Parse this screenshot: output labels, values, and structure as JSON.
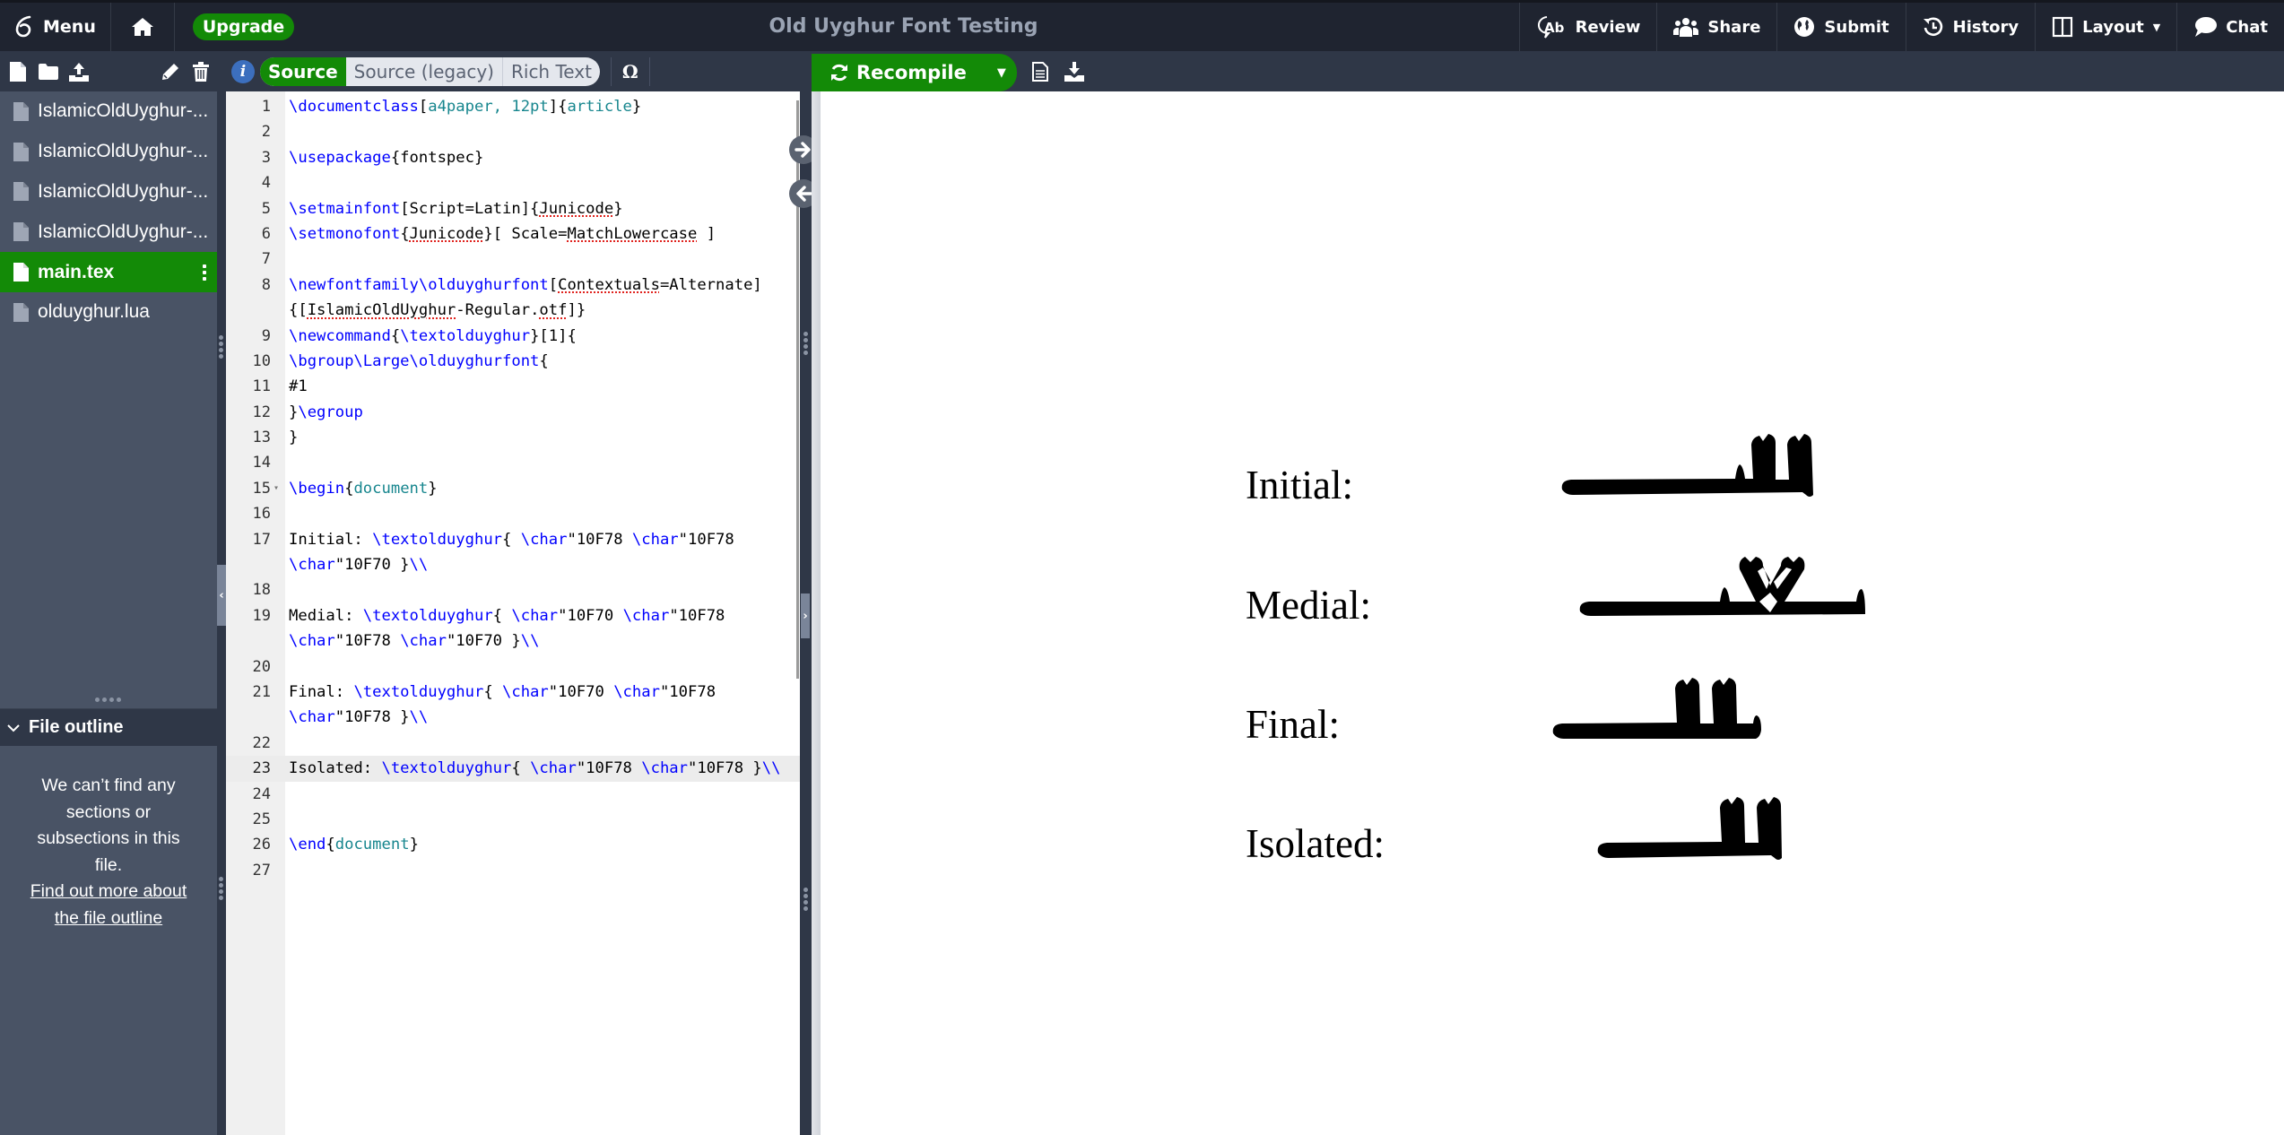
{
  "topbar": {
    "menu_label": "Menu",
    "upgrade_label": "Upgrade",
    "project_title": "Old Uyghur Font Testing",
    "actions": [
      {
        "label": "Review",
        "icon": "review-icon"
      },
      {
        "label": "Share",
        "icon": "share-icon"
      },
      {
        "label": "Submit",
        "icon": "globe-icon"
      },
      {
        "label": "History",
        "icon": "history-icon"
      },
      {
        "label": "Layout",
        "icon": "layout-icon"
      },
      {
        "label": "Chat",
        "icon": "chat-icon"
      }
    ]
  },
  "editor_toolbar": {
    "modes": [
      "Source",
      "Source (legacy)",
      "Rich Text"
    ],
    "active_mode": "Source",
    "omega": "Ω"
  },
  "pdf_toolbar": {
    "recompile_label": "Recompile"
  },
  "file_tree": {
    "files": [
      {
        "name": "IslamicOldUyghur-...",
        "selected": false
      },
      {
        "name": "IslamicOldUyghur-...",
        "selected": false
      },
      {
        "name": "IslamicOldUyghur-...",
        "selected": false
      },
      {
        "name": "IslamicOldUyghur-...",
        "selected": false
      },
      {
        "name": "main.tex",
        "selected": true
      },
      {
        "name": "olduyghur.lua",
        "selected": false
      }
    ]
  },
  "file_outline": {
    "title": "File outline",
    "empty_message": "We can’t find any sections or subsections in this file.",
    "link_text": "Find out more about the file outline"
  },
  "editor": {
    "active_line": 23,
    "lines": [
      {
        "n": "1",
        "segs": [
          [
            "kw",
            "\\documentclass"
          ],
          [
            "",
            "["
          ],
          [
            "arg",
            "a4paper, 12pt"
          ],
          [
            "",
            "]{"
          ],
          [
            "arg",
            "article"
          ],
          [
            "",
            "}"
          ]
        ]
      },
      {
        "n": "2",
        "segs": []
      },
      {
        "n": "3",
        "segs": [
          [
            "kw",
            "\\usepackage"
          ],
          [
            "",
            "{fontspec}"
          ]
        ]
      },
      {
        "n": "4",
        "segs": []
      },
      {
        "n": "5",
        "segs": [
          [
            "kw",
            "\\setmainfont"
          ],
          [
            "",
            "[Script=Latin]{"
          ],
          [
            "sp",
            "Junicode"
          ],
          [
            "",
            "}"
          ]
        ]
      },
      {
        "n": "6",
        "segs": [
          [
            "kw",
            "\\setmonofont"
          ],
          [
            "",
            "{"
          ],
          [
            "sp",
            "Junicode"
          ],
          [
            "",
            "}[ Scale="
          ],
          [
            "sp",
            "MatchLowercase"
          ],
          [
            "",
            " ]"
          ]
        ]
      },
      {
        "n": "7",
        "segs": []
      },
      {
        "n": "8",
        "segs": [
          [
            "kw",
            "\\newfontfamily\\olduyghurfont"
          ],
          [
            "",
            "["
          ],
          [
            "sp",
            "Contextuals"
          ],
          [
            "",
            "=Alternate]"
          ]
        ]
      },
      {
        "n": "",
        "segs": [
          [
            "",
            "{["
          ],
          [
            "sp",
            "IslamicOldUyghur"
          ],
          [
            "",
            "-Regular."
          ],
          [
            "sp",
            "otf"
          ],
          [
            "",
            "]}"
          ]
        ]
      },
      {
        "n": "9",
        "segs": [
          [
            "kw",
            "\\newcommand"
          ],
          [
            "",
            "{"
          ],
          [
            "kw",
            "\\textolduyghur"
          ],
          [
            "",
            "}[1]{"
          ]
        ]
      },
      {
        "n": "10",
        "segs": [
          [
            "kw",
            "\\bgroup\\Large\\olduyghurfont"
          ],
          [
            "",
            "{"
          ]
        ]
      },
      {
        "n": "11",
        "segs": [
          [
            "",
            "#1"
          ]
        ]
      },
      {
        "n": "12",
        "segs": [
          [
            "",
            "}"
          ],
          [
            "kw",
            "\\egroup"
          ]
        ]
      },
      {
        "n": "13",
        "segs": [
          [
            "",
            "}"
          ]
        ]
      },
      {
        "n": "14",
        "segs": []
      },
      {
        "n": "15",
        "fold": true,
        "segs": [
          [
            "kw",
            "\\begin"
          ],
          [
            "",
            "{"
          ],
          [
            "arg",
            "document"
          ],
          [
            "",
            "}"
          ]
        ]
      },
      {
        "n": "16",
        "segs": []
      },
      {
        "n": "17",
        "segs": [
          [
            "",
            "Initial: "
          ],
          [
            "kw",
            "\\textolduyghur"
          ],
          [
            "",
            "{ "
          ],
          [
            "kw",
            "\\char"
          ],
          [
            "",
            "\"10F78 "
          ],
          [
            "kw",
            "\\char"
          ],
          [
            "",
            "\"10F78"
          ]
        ]
      },
      {
        "n": "",
        "segs": [
          [
            "kw",
            "\\char"
          ],
          [
            "",
            "\"10F70 }"
          ],
          [
            "kw",
            "\\\\"
          ]
        ]
      },
      {
        "n": "18",
        "segs": []
      },
      {
        "n": "19",
        "segs": [
          [
            "",
            "Medial: "
          ],
          [
            "kw",
            "\\textolduyghur"
          ],
          [
            "",
            "{ "
          ],
          [
            "kw",
            "\\char"
          ],
          [
            "",
            "\"10F70 "
          ],
          [
            "kw",
            "\\char"
          ],
          [
            "",
            "\"10F78"
          ]
        ]
      },
      {
        "n": "",
        "segs": [
          [
            "kw",
            "\\char"
          ],
          [
            "",
            "\"10F78 "
          ],
          [
            "kw",
            "\\char"
          ],
          [
            "",
            "\"10F70 }"
          ],
          [
            "kw",
            "\\\\"
          ]
        ]
      },
      {
        "n": "20",
        "segs": []
      },
      {
        "n": "21",
        "segs": [
          [
            "",
            "Final: "
          ],
          [
            "kw",
            "\\textolduyghur"
          ],
          [
            "",
            "{ "
          ],
          [
            "kw",
            "\\char"
          ],
          [
            "",
            "\"10F70 "
          ],
          [
            "kw",
            "\\char"
          ],
          [
            "",
            "\"10F78"
          ]
        ]
      },
      {
        "n": "",
        "segs": [
          [
            "kw",
            "\\char"
          ],
          [
            "",
            "\"10F78 }"
          ],
          [
            "kw",
            "\\\\"
          ]
        ]
      },
      {
        "n": "22",
        "segs": []
      },
      {
        "n": "23",
        "segs": [
          [
            "",
            "Isolated: "
          ],
          [
            "kw",
            "\\textolduyghur"
          ],
          [
            "",
            "{ "
          ],
          [
            "kw",
            "\\char"
          ],
          [
            "",
            "\"10F78 "
          ],
          [
            "kw",
            "\\char"
          ],
          [
            "",
            "\"10F78 }"
          ],
          [
            "kw",
            "\\\\"
          ]
        ]
      },
      {
        "n": "24",
        "segs": []
      },
      {
        "n": "25",
        "segs": []
      },
      {
        "n": "26",
        "segs": [
          [
            "kw",
            "\\end"
          ],
          [
            "",
            "{"
          ],
          [
            "arg",
            "document"
          ],
          [
            "",
            "}"
          ]
        ]
      },
      {
        "n": "27",
        "segs": []
      }
    ]
  },
  "pdf_preview": {
    "rows": [
      {
        "label": "Initial:",
        "glyph": "initial"
      },
      {
        "label": "Medial:",
        "glyph": "medial"
      },
      {
        "label": "Final:",
        "glyph": "final"
      },
      {
        "label": "Isolated:",
        "glyph": "isolated"
      }
    ]
  },
  "colors": {
    "accent_green": "#138a07",
    "topbar_bg": "#1f2430",
    "toolbar_bg": "#2f3747",
    "sidebar_bg": "#495365",
    "keyword_blue": "#0000ff",
    "argument_teal": "#17868e"
  }
}
